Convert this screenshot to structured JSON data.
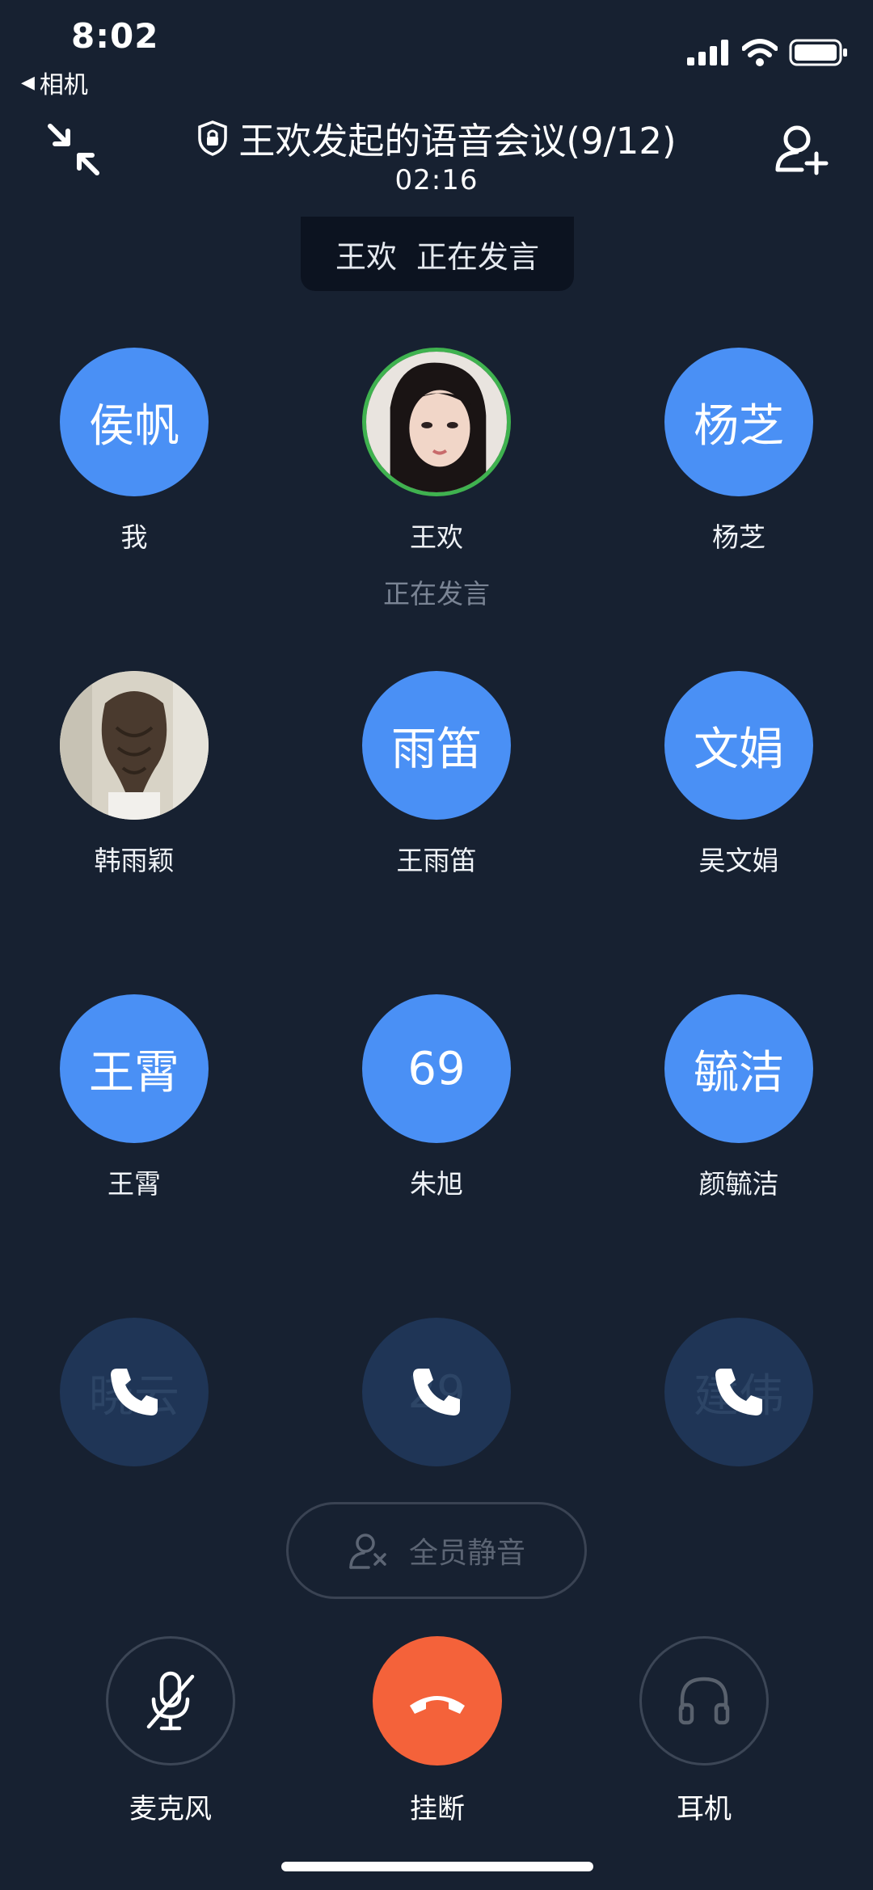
{
  "status_bar": {
    "time": "8:02",
    "back_label": "相机"
  },
  "header": {
    "title": "王欢发起的语音会议(9/12)",
    "timer": "02:16"
  },
  "banner": {
    "name": "王欢",
    "status": "正在发言"
  },
  "participants": [
    {
      "avatar_text": "侯帆",
      "name": "我",
      "status": ""
    },
    {
      "avatar_text": "",
      "name": "王欢",
      "status": "正在发言"
    },
    {
      "avatar_text": "杨芝",
      "name": "杨芝",
      "status": ""
    },
    {
      "avatar_text": "",
      "name": "韩雨颖",
      "status": ""
    },
    {
      "avatar_text": "雨笛",
      "name": "王雨笛",
      "status": ""
    },
    {
      "avatar_text": "文娟",
      "name": "吴文娟",
      "status": ""
    },
    {
      "avatar_text": "王霄",
      "name": "王霄",
      "status": ""
    },
    {
      "avatar_text": "69",
      "name": "朱旭",
      "status": ""
    },
    {
      "avatar_text": "毓洁",
      "name": "颜毓洁",
      "status": ""
    },
    {
      "avatar_text": "晓云",
      "name": "",
      "status": ""
    },
    {
      "avatar_text": "29",
      "name": "",
      "status": ""
    },
    {
      "avatar_text": "建伟",
      "name": "",
      "status": ""
    }
  ],
  "mute_all": {
    "label": "全员静音"
  },
  "controls": {
    "mic_label": "麦克风",
    "hangup_label": "挂断",
    "headset_label": "耳机"
  },
  "colors": {
    "background": "#172131",
    "avatar_blue": "#4a90f5",
    "speaking_ring": "#3fb24f",
    "hangup": "#f4623a"
  },
  "icons": {
    "collapse": "collapse-arrows-icon",
    "add_user": "add-user-icon",
    "lock": "lock-icon",
    "phone": "phone-icon",
    "mic_off": "mic-off-icon",
    "hangup": "hangup-icon",
    "headset": "headset-icon"
  }
}
